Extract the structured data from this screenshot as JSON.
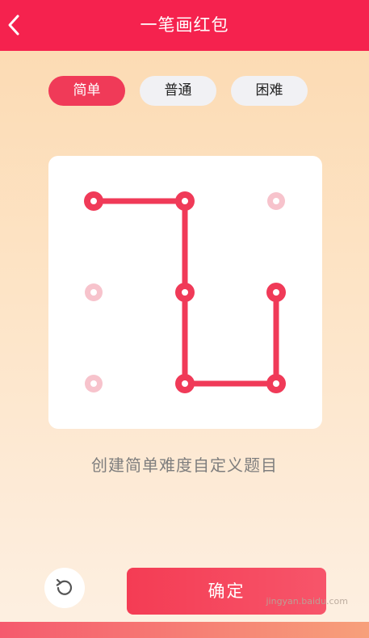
{
  "header": {
    "title": "一笔画红包",
    "back_icon": "chevron-left-icon"
  },
  "tabs": [
    {
      "label": "简单",
      "active": true
    },
    {
      "label": "普通",
      "active": false
    },
    {
      "label": "困难",
      "active": false
    }
  ],
  "puzzle": {
    "grid_size": 3,
    "active_dots": [
      [
        0,
        0
      ],
      [
        1,
        0
      ],
      [
        1,
        1
      ],
      [
        1,
        2
      ],
      [
        2,
        2
      ],
      [
        2,
        1
      ]
    ],
    "inactive_dots": [
      [
        2,
        0
      ],
      [
        0,
        1
      ],
      [
        0,
        2
      ]
    ],
    "path": [
      [
        0,
        0
      ],
      [
        1,
        0
      ],
      [
        1,
        1
      ],
      [
        1,
        2
      ],
      [
        2,
        2
      ],
      [
        2,
        1
      ]
    ],
    "line_color": "#f03a58",
    "inactive_color": "#f7c3cc"
  },
  "description": "创建简单难度自定义题目",
  "actions": {
    "refresh_icon": "refresh-icon",
    "confirm_label": "确定"
  },
  "watermark": {
    "text": "jingyan.baidu.com"
  }
}
